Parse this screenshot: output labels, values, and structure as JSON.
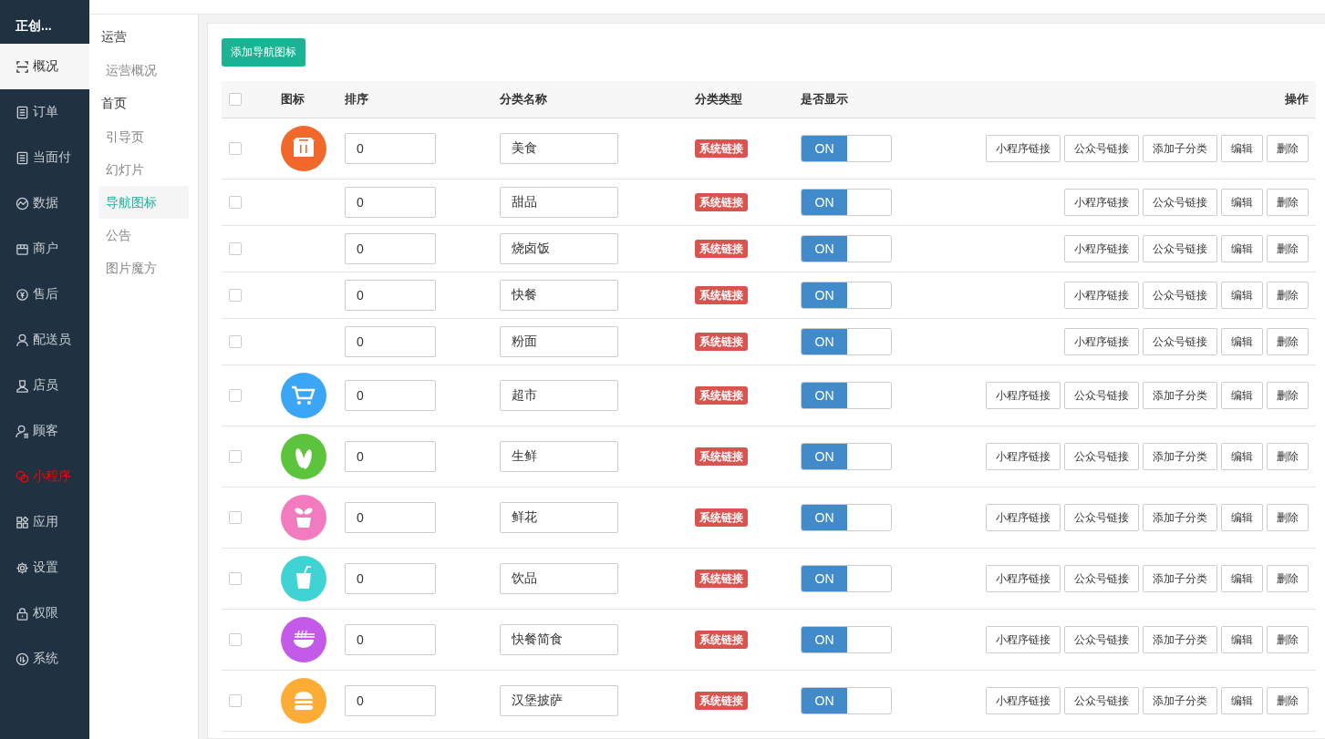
{
  "sidebar": {
    "brand": "正创...",
    "items": [
      {
        "label": "概况",
        "kind": "frame",
        "highlighted": true,
        "selected": false
      },
      {
        "label": "订单",
        "kind": "list",
        "highlighted": false,
        "selected": false
      },
      {
        "label": "当面付",
        "kind": "list",
        "highlighted": false,
        "selected": false
      },
      {
        "label": "数据",
        "kind": "chart",
        "highlighted": false,
        "selected": false
      },
      {
        "label": "商户",
        "kind": "store",
        "highlighted": false,
        "selected": false
      },
      {
        "label": "售后",
        "kind": "refund",
        "highlighted": false,
        "selected": false
      },
      {
        "label": "配送员",
        "kind": "person",
        "highlighted": false,
        "selected": false
      },
      {
        "label": "店员",
        "kind": "clerk",
        "highlighted": false,
        "selected": false
      },
      {
        "label": "顾客",
        "kind": "customer",
        "highlighted": false,
        "selected": false
      },
      {
        "label": "小程序",
        "kind": "chat",
        "highlighted": false,
        "selected": true
      },
      {
        "label": "应用",
        "kind": "apps",
        "highlighted": false,
        "selected": false
      },
      {
        "label": "设置",
        "kind": "gear",
        "highlighted": false,
        "selected": false
      },
      {
        "label": "权限",
        "kind": "lock",
        "highlighted": false,
        "selected": false
      },
      {
        "label": "系统",
        "kind": "system",
        "highlighted": false,
        "selected": false
      }
    ]
  },
  "subnav": {
    "groups": [
      {
        "title": "运营",
        "items": [
          {
            "label": "运营概况",
            "selected": false
          }
        ]
      },
      {
        "title": "首页",
        "items": [
          {
            "label": "引导页",
            "selected": false
          },
          {
            "label": "幻灯片",
            "selected": false
          },
          {
            "label": "导航图标",
            "selected": true
          },
          {
            "label": "公告",
            "selected": false
          },
          {
            "label": "图片魔方",
            "selected": false
          }
        ]
      }
    ]
  },
  "add_button": "添加导航图标",
  "table": {
    "select_all": {
      "checked": false
    },
    "columns": [
      "图标",
      "排序",
      "分类名称",
      "分类类型",
      "是否显示",
      "操作"
    ],
    "rows": [
      {
        "checked": false,
        "icon": {
          "kind": "box",
          "color": "#f0692a"
        },
        "sort": "0",
        "name": "美食",
        "type": "系统链接",
        "display": {
          "on": true,
          "label": "ON"
        },
        "actions": [
          "小程序链接",
          "公众号链接",
          "添加子分类",
          "编辑",
          "删除"
        ]
      },
      {
        "checked": false,
        "sort": "0",
        "name": "甜品",
        "type": "系统链接",
        "display": {
          "on": true,
          "label": "ON"
        },
        "actions": [
          "小程序链接",
          "公众号链接",
          "编辑",
          "删除"
        ]
      },
      {
        "checked": false,
        "sort": "0",
        "name": "烧卤饭",
        "type": "系统链接",
        "display": {
          "on": true,
          "label": "ON"
        },
        "actions": [
          "小程序链接",
          "公众号链接",
          "编辑",
          "删除"
        ]
      },
      {
        "checked": false,
        "sort": "0",
        "name": "快餐",
        "type": "系统链接",
        "display": {
          "on": true,
          "label": "ON"
        },
        "actions": [
          "小程序链接",
          "公众号链接",
          "编辑",
          "删除"
        ]
      },
      {
        "checked": false,
        "sort": "0",
        "name": "粉面",
        "type": "系统链接",
        "display": {
          "on": true,
          "label": "ON"
        },
        "actions": [
          "小程序链接",
          "公众号链接",
          "编辑",
          "删除"
        ]
      },
      {
        "checked": false,
        "icon": {
          "kind": "cart",
          "color": "#3aa6f5"
        },
        "sort": "0",
        "name": "超市",
        "type": "系统链接",
        "display": {
          "on": true,
          "label": "ON"
        },
        "actions": [
          "小程序链接",
          "公众号链接",
          "添加子分类",
          "编辑",
          "删除"
        ]
      },
      {
        "checked": false,
        "icon": {
          "kind": "vegetable",
          "color": "#5cc43c"
        },
        "sort": "0",
        "name": "生鲜",
        "type": "系统链接",
        "display": {
          "on": true,
          "label": "ON"
        },
        "actions": [
          "小程序链接",
          "公众号链接",
          "添加子分类",
          "编辑",
          "删除"
        ]
      },
      {
        "checked": false,
        "icon": {
          "kind": "plant",
          "color": "#f27bbf"
        },
        "sort": "0",
        "name": "鲜花",
        "type": "系统链接",
        "display": {
          "on": true,
          "label": "ON"
        },
        "actions": [
          "小程序链接",
          "公众号链接",
          "添加子分类",
          "编辑",
          "删除"
        ]
      },
      {
        "checked": false,
        "icon": {
          "kind": "drink",
          "color": "#3fd3d3"
        },
        "sort": "0",
        "name": "饮品",
        "type": "系统链接",
        "display": {
          "on": true,
          "label": "ON"
        },
        "actions": [
          "小程序链接",
          "公众号链接",
          "添加子分类",
          "编辑",
          "删除"
        ]
      },
      {
        "checked": false,
        "icon": {
          "kind": "noodle",
          "color": "#c35ae8"
        },
        "sort": "0",
        "name": "快餐简食",
        "type": "系统链接",
        "display": {
          "on": true,
          "label": "ON"
        },
        "actions": [
          "小程序链接",
          "公众号链接",
          "添加子分类",
          "编辑",
          "删除"
        ]
      },
      {
        "checked": false,
        "icon": {
          "kind": "burger",
          "color": "#fdad35"
        },
        "sort": "0",
        "name": "汉堡披萨",
        "type": "系统链接",
        "display": {
          "on": true,
          "label": "ON"
        },
        "actions": [
          "小程序链接",
          "公众号链接",
          "添加子分类",
          "编辑",
          "删除"
        ]
      }
    ]
  }
}
